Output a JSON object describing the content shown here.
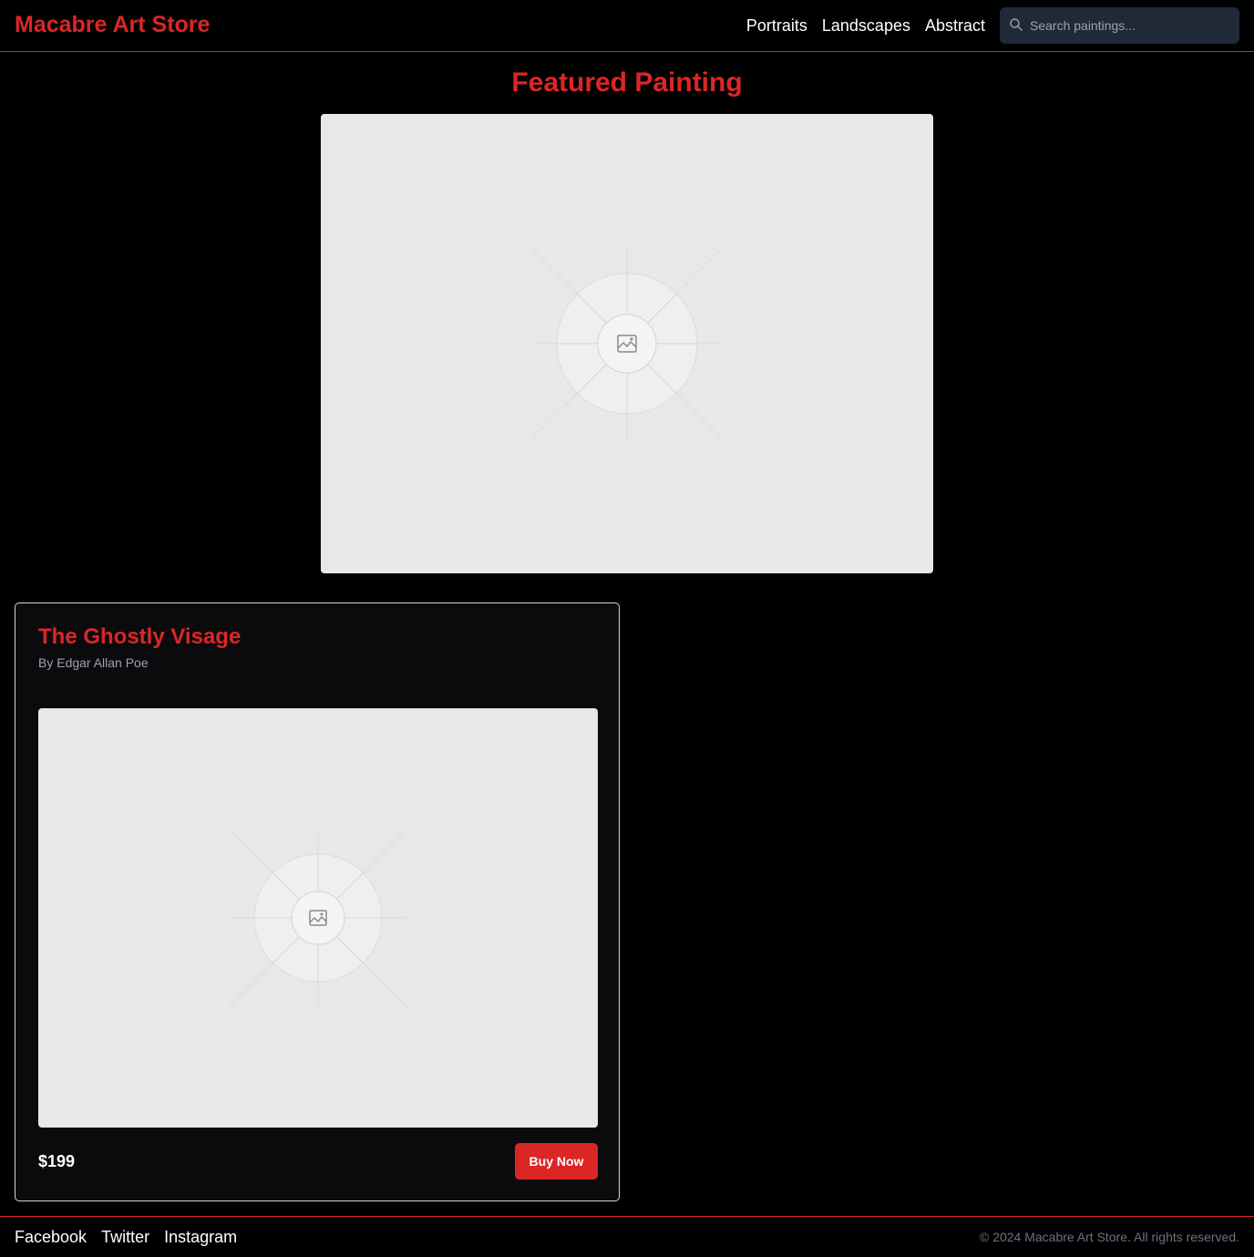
{
  "header": {
    "brand": "Macabre Art Store",
    "nav": [
      "Portraits",
      "Landscapes",
      "Abstract"
    ],
    "search_placeholder": "Search paintings..."
  },
  "featured": {
    "title": "Featured Painting",
    "image_icon": "image-placeholder-icon"
  },
  "card": {
    "title": "The Ghostly Visage",
    "artist": "By Edgar Allan Poe",
    "price": "$199",
    "buy_label": "Buy Now",
    "image_icon": "image-placeholder-icon"
  },
  "footer": {
    "social": [
      "Facebook",
      "Twitter",
      "Instagram"
    ],
    "copyright": "© 2024 Macabre Art Store. All rights reserved."
  },
  "colors": {
    "accent": "#dc2626",
    "background": "#000000",
    "card_background": "#0b0b0e",
    "search_background": "#1f2937",
    "placeholder_background": "#e8e8e8"
  }
}
